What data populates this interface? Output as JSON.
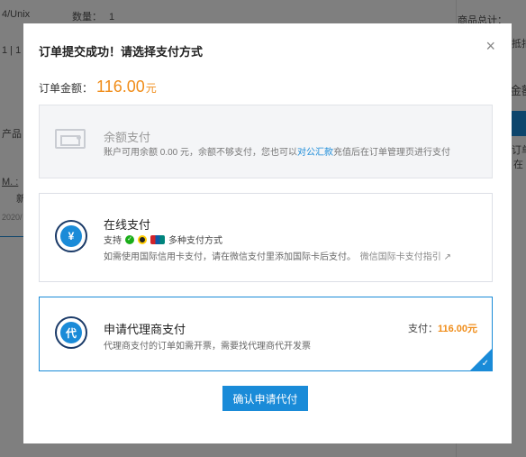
{
  "background": {
    "row1_left": "4/Unix",
    "row1_qty_label": "数量：",
    "row1_qty_value": "1",
    "row1_right": "商品总计：",
    "row2_left": "1 | 1",
    "row2_right": "抵扣",
    "row3_right": "金额",
    "row4_left": "产品",
    "row5_right": "订单",
    "row6_right": "在",
    "row7_left": "M. :",
    "row8_left": "新",
    "row9_left": "2020/"
  },
  "modal": {
    "title": "订单提交成功！请选择支付方式",
    "close_glyph": "×",
    "amount_label": "订单金额：",
    "amount_value": "116.00",
    "amount_unit": "元"
  },
  "options": {
    "balance": {
      "title": "余额支付",
      "desc_prefix": "账户可用余额 0.00 元，余额不够支付，您也可以",
      "desc_link": "对公汇款",
      "desc_suffix": "充值后在订单管理页进行支付"
    },
    "online": {
      "title": "在线支付",
      "support_label": "支持",
      "support_suffix": "多种支付方式",
      "desc": "如需使用国际信用卡支付，请在微信支付里添加国际卡后支付。",
      "desc_link": "微信国际卡支付指引",
      "icon_glyph": "¥"
    },
    "agent": {
      "title": "申请代理商支付",
      "desc": "代理商支付的订单如需开票，需要找代理商代开发票",
      "pay_label": "支付：",
      "pay_value": "116.00元",
      "icon_glyph": "代",
      "check_glyph": "✓"
    }
  },
  "confirm_label": "确认申请代付",
  "colors": {
    "accent": "#1a8bd8",
    "price": "#f08d1a"
  }
}
